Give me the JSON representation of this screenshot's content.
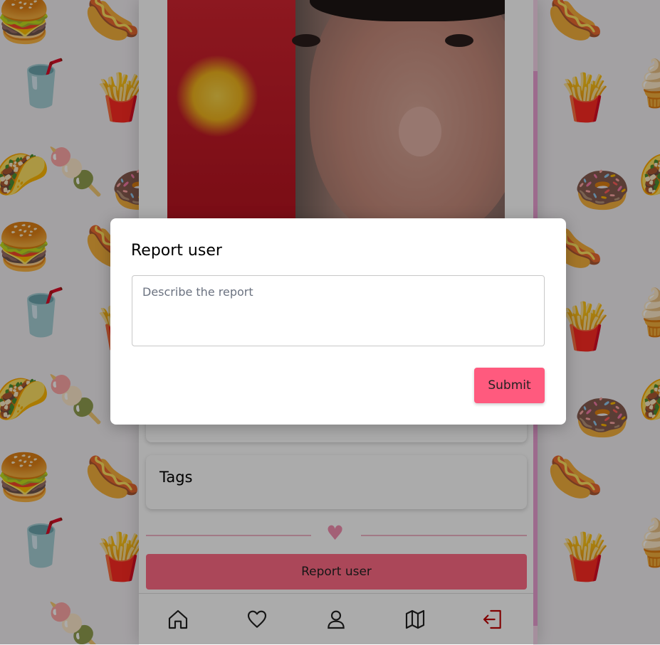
{
  "colors": {
    "accent": "#ff5a7e",
    "report_button": "#ff6b85",
    "pattern": "#e7b9e2",
    "logout": "#c00000"
  },
  "background_pattern": {
    "icons": [
      "burger-icon",
      "soda-cup-icon",
      "ice-pop-icon",
      "taco-icon",
      "hotdog-icon",
      "fries-icon",
      "donut-icon",
      "ice-cream-icon"
    ]
  },
  "profile": {
    "photo_alt": "",
    "cards": [
      {
        "title": ""
      },
      {
        "title": "Tags"
      }
    ],
    "separator_icon": "heart-icon",
    "report_label": "Report user"
  },
  "bottom_nav": {
    "items": [
      {
        "icon": "home-icon"
      },
      {
        "icon": "heart-icon"
      },
      {
        "icon": "user-icon"
      },
      {
        "icon": "map-icon"
      },
      {
        "icon": "logout-icon"
      }
    ]
  },
  "modal": {
    "title": "Report user",
    "textarea_placeholder": "Describe the report",
    "textarea_value": "",
    "submit_label": "Submit"
  }
}
